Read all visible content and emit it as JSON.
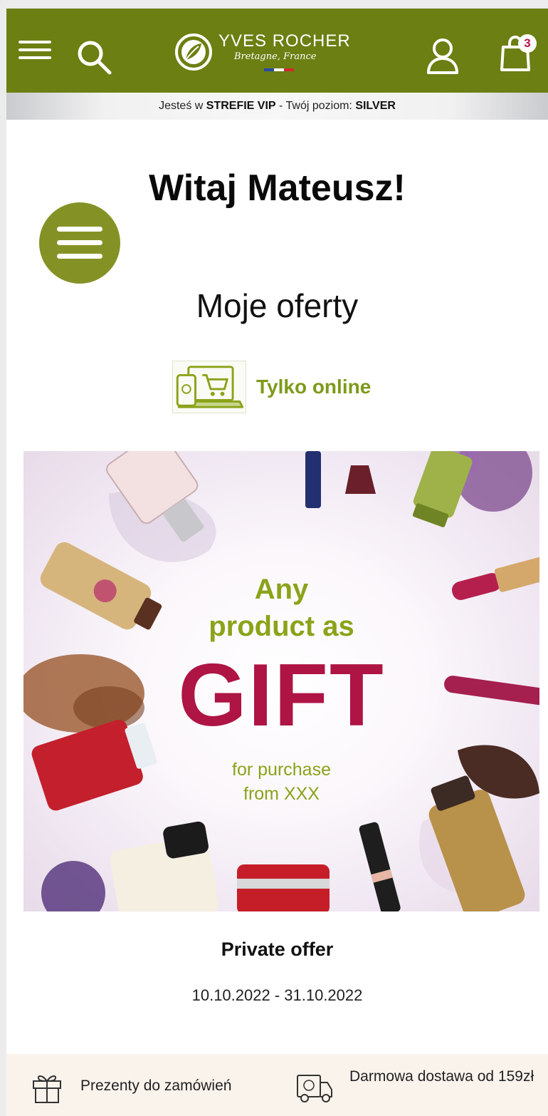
{
  "header": {
    "brand_name": "YVES ROCHER",
    "brand_tagline": "Bretagne, France",
    "cart_count": "3",
    "brand_color": "#6b7f12"
  },
  "vip_bar": {
    "prefix": "Jesteś w ",
    "zone": "STREFIE VIP",
    "middle": " - Twój poziom: ",
    "level": "SILVER"
  },
  "welcome": {
    "greeting": "Witaj Mateusz!"
  },
  "offers": {
    "title": "Moje oferty",
    "channel_label": "Tylko online",
    "channel_icon": "online-shop-icon"
  },
  "banner": {
    "line1": "Any",
    "line2": "product as",
    "headline": "GIFT",
    "sub1": "for purchase",
    "sub2": "from XXX",
    "accent_green": "#8aa31a",
    "accent_red": "#ae1444"
  },
  "offer": {
    "name": "Private offer",
    "dates": "10.10.2022 - 31.10.2022"
  },
  "benefits": {
    "gifts": "Prezenty do zamówień",
    "delivery": "Darmowa dostawa od 159zł"
  },
  "icons": [
    "menu-icon",
    "search-icon",
    "user-icon",
    "shopping-bag-icon",
    "gift-icon",
    "delivery-truck-icon"
  ]
}
